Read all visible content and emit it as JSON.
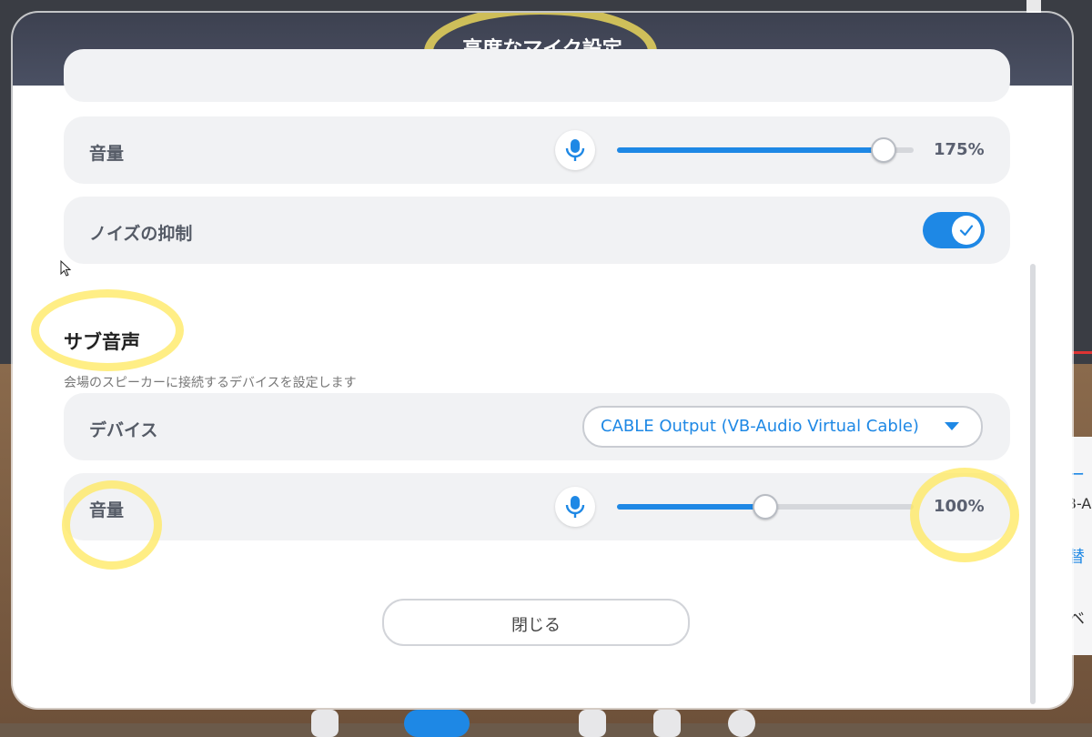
{
  "modal": {
    "title": "高度なマイク設定",
    "primary_volume": {
      "label": "音量",
      "value_label": "175%",
      "level": 0.9
    },
    "noise_suppression": {
      "label": "ノイズの抑制",
      "enabled": true
    },
    "sub_audio": {
      "title": "サブ音声",
      "description": "会場のスピーカーに接続するデバイスを設定します",
      "device": {
        "label": "デバイス",
        "selected": "CABLE Output (VB-Audio Virtual Cable)"
      },
      "volume": {
        "label": "音量",
        "value_label": "100%",
        "level": 0.5
      }
    },
    "close_label": "閉じる"
  },
  "side_panel": {
    "t1": "ー",
    "t2": "B-A",
    "t3": "替",
    "t4": "ベ"
  },
  "colors": {
    "accent": "#1e88e5",
    "header": "#434858",
    "highlight": "#ffe85c"
  }
}
